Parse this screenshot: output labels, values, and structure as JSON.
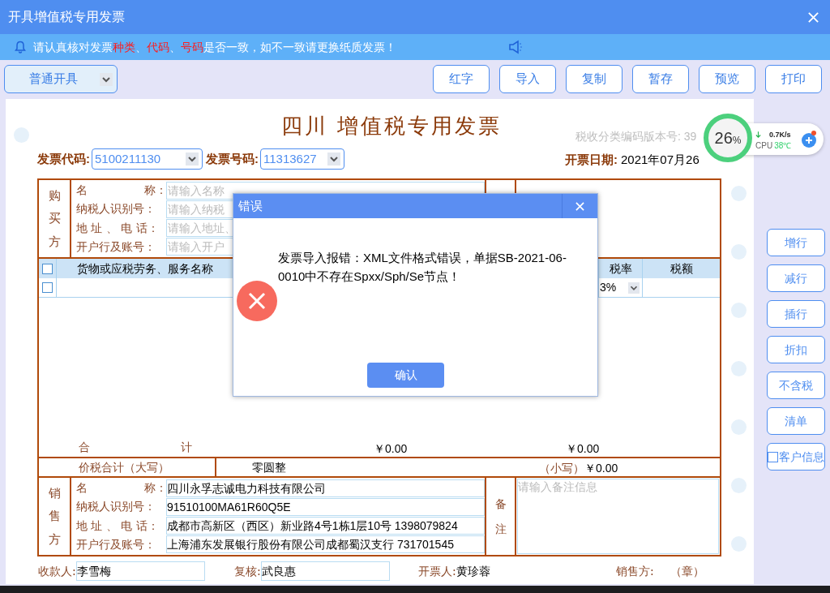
{
  "window": {
    "title": "开具增值税专用发票"
  },
  "notice": {
    "segments": [
      {
        "text": "请认真核对发票",
        "highlight": false
      },
      {
        "text": "种类",
        "highlight": true
      },
      {
        "text": "、",
        "highlight": false
      },
      {
        "text": "代码",
        "highlight": true
      },
      {
        "text": "、",
        "highlight": false
      },
      {
        "text": "号码",
        "highlight": true
      },
      {
        "text": "是否一致，如不一致请更换纸质发票！",
        "highlight": false
      }
    ]
  },
  "toolbar": {
    "mode": "普通开具",
    "buttons": [
      "红字",
      "导入",
      "复制",
      "暂存",
      "预览",
      "打印"
    ]
  },
  "invoice": {
    "title": "四川 增值税专用发票",
    "version": "税收分类编码版本号: 39",
    "code_label": "发票代码:",
    "code": "5100211130",
    "number_label": "发票号码:",
    "number": "11313627",
    "date_label": "开票日期:",
    "date": "2021年07月26",
    "buyer": {
      "side_label": "购买方",
      "fields": [
        {
          "label": "名　　　　　称：",
          "placeholder": "请输入名称"
        },
        {
          "label": "纳税人识别号：",
          "placeholder": "请输入纳税"
        },
        {
          "label": "地 址 、 电 话：",
          "placeholder": "请输入地址、"
        },
        {
          "label": "开户行及账号：",
          "placeholder": "请输入开户"
        }
      ]
    },
    "goods": {
      "columns": [
        "货物或应税劳务、服务名称",
        "税率",
        "税额"
      ],
      "header_checked": false,
      "rows": [
        {
          "checked": false,
          "rate": "3%"
        }
      ]
    },
    "total": {
      "label": "合　　　　　　　　计",
      "amount": "￥0.00",
      "tax": "￥0.00"
    },
    "grand": {
      "label": "价税合计（大写）",
      "words": "零圆整",
      "small_label": "（小写）",
      "small": "￥0.00"
    },
    "seller": {
      "side_label": "销售方",
      "fields": [
        {
          "label": "名　　　　　称：",
          "value": "四川永孚志诚电力科技有限公司"
        },
        {
          "label": "纳税人识别号：",
          "value": "91510100MA61R60Q5E"
        },
        {
          "label": "地 址 、 电 话：",
          "value": "成都市高新区（西区）新业路4号1栋1层10号 1398079824"
        },
        {
          "label": "开户行及账号：",
          "value": "上海浦东发展银行股份有限公司成都蜀汉支行 731701545"
        }
      ]
    },
    "remark": {
      "label": "备注",
      "placeholder": "请输入备注信息"
    },
    "footer": [
      {
        "label": "收款人:",
        "value": "李雪梅",
        "kind": "field"
      },
      {
        "label": "复核:",
        "value": "武良惠",
        "kind": "field"
      },
      {
        "label": "开票人:",
        "value": "黄珍蓉",
        "kind": "text"
      },
      {
        "label": "销售方:",
        "value": "（章）",
        "kind": "stamp"
      }
    ]
  },
  "side_buttons": [
    {
      "label": "增行",
      "kind": "button"
    },
    {
      "label": "减行",
      "kind": "button"
    },
    {
      "label": "插行",
      "kind": "button"
    },
    {
      "label": "折扣",
      "kind": "button"
    },
    {
      "label": "不含税",
      "kind": "button"
    },
    {
      "label": "清单",
      "kind": "button"
    },
    {
      "label": "客户信息",
      "kind": "checkbox",
      "checked": false
    }
  ],
  "monitor": {
    "percent": "26",
    "unit": "%",
    "net": "0.7K/s",
    "cpu_label": "CPU",
    "temp": "38℃"
  },
  "dialog": {
    "title": "错误",
    "message": "发票导入报错：XML文件格式错误，单据SB-2021-06-0010中不存在Spxx/Sph/Se节点！",
    "button": "确认"
  }
}
